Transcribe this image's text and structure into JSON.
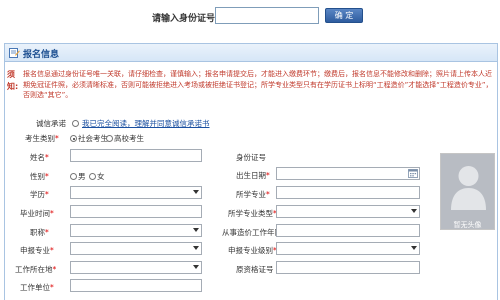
{
  "id_query": {
    "label": "请输入身份证号：",
    "input_value": "",
    "confirm_label": "确 定"
  },
  "panel": {
    "title": "报名信息"
  },
  "notice": {
    "label": "须知:",
    "text": "报名信息通过身份证号唯一关联，请仔细检查，谨慎输入；报名申请提交后，才能进入缴费环节；缴费后，报名信息不能修改和删除；照片请上传本人近期免冠证件照，必须清晰标准，否则可能被拒绝进入考场或被拒绝证书登记；所学专业类型只有在学历证书上标明“工程造价”才能选择“工程造价专业”，否则选“其它”。"
  },
  "form": {
    "integrity": {
      "label": "诚信承诺",
      "link_text": "我已完全阅读，理解并同意诚信承诺书"
    },
    "candidate_type": {
      "label": "考生类别",
      "options": [
        "社会考生",
        "高校考生"
      ],
      "selected": "社会考生"
    },
    "name": {
      "label": "姓名",
      "value": ""
    },
    "gender": {
      "label": "性别",
      "options": [
        "男",
        "女"
      ],
      "selected": ""
    },
    "education": {
      "label": "学历",
      "value": ""
    },
    "grad_date": {
      "label": "毕业时间",
      "value": ""
    },
    "title_level": {
      "label": "职称",
      "value": ""
    },
    "apply_major": {
      "label": "申报专业",
      "value": ""
    },
    "work_location": {
      "label": "工作所在地",
      "value": ""
    },
    "employer": {
      "label": "工作单位",
      "value": ""
    },
    "id_number": {
      "label": "身份证号",
      "value": ""
    },
    "birth_date": {
      "label": "出生日期",
      "value": ""
    },
    "major": {
      "label": "所学专业",
      "value": ""
    },
    "major_type": {
      "label": "所学专业类型",
      "value": ""
    },
    "work_years": {
      "label": "从事造价工作年限",
      "value": ""
    },
    "apply_level": {
      "label": "申报专业级别",
      "value": ""
    },
    "cert_number": {
      "label": "原资格证号",
      "value": ""
    },
    "required_mark": "*"
  },
  "photo": {
    "caption": "暂无头像"
  },
  "colors": {
    "accent": "#1d4f91",
    "notice": "#c0392b",
    "button": "#2e5c9f",
    "required": "#dd0000"
  }
}
